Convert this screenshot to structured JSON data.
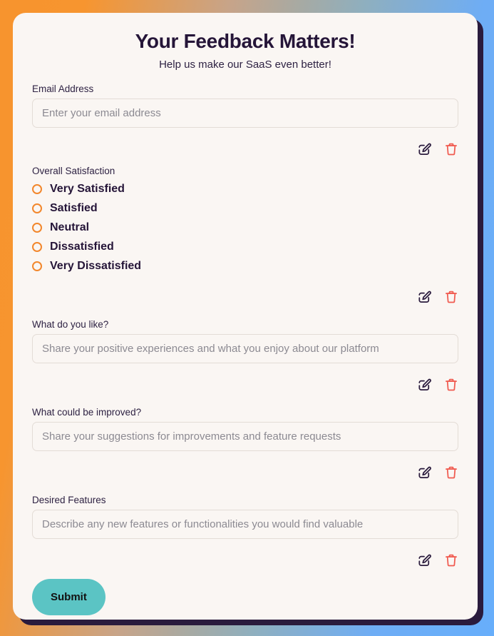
{
  "theme": {
    "frame_gradient_start": "#F7942E",
    "frame_gradient_end": "#67AEFB",
    "card_background": "#FAF6F3",
    "card_shadow": "#2A1B3D",
    "heading_color": "#251538",
    "radio_accent": "#F2872C",
    "edit_icon_color": "#2A1B3D",
    "delete_icon_color": "#F05A4F",
    "submit_background": "#5BC4C4",
    "submit_text_color": "#121212",
    "placeholder_color": "#8C8A92"
  },
  "header": {
    "title": "Your Feedback Matters!",
    "subtitle": "Help us make our SaaS even better!"
  },
  "icons": {
    "edit": "edit-icon",
    "delete": "trash-icon"
  },
  "fields": {
    "email": {
      "label": "Email Address",
      "placeholder": "Enter your email address",
      "value": ""
    },
    "satisfaction": {
      "label": "Overall Satisfaction",
      "selected": "",
      "options": [
        "Very Satisfied",
        "Satisfied",
        "Neutral",
        "Dissatisfied",
        "Very Dissatisfied"
      ]
    },
    "likes": {
      "label": "What do you like?",
      "placeholder": "Share your positive experiences and what you enjoy about our platform",
      "value": ""
    },
    "improvements": {
      "label": "What could be improved?",
      "placeholder": "Share your suggestions for improvements and feature requests",
      "value": ""
    },
    "features": {
      "label": "Desired Features",
      "placeholder": "Describe any new features or functionalities you would find valuable",
      "value": ""
    }
  },
  "actions": {
    "submit_label": "Submit"
  }
}
